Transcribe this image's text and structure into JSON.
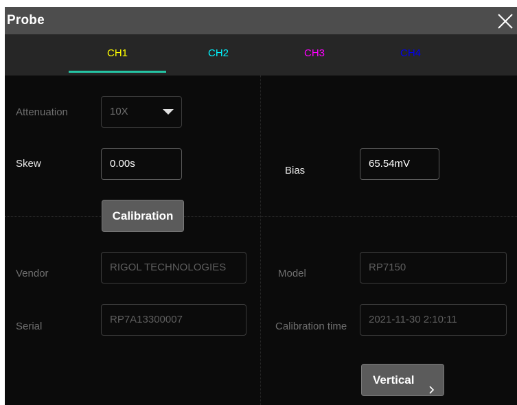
{
  "dialog": {
    "title": "Probe",
    "close_icon": "close-icon"
  },
  "tabs": [
    {
      "label": "CH1",
      "color": "#ffff00",
      "active": true
    },
    {
      "label": "CH2",
      "color": "#00f5ff",
      "active": false
    },
    {
      "label": "CH3",
      "color": "#ff00ff",
      "active": false
    },
    {
      "label": "CH4",
      "color": "#0000ee",
      "active": false
    }
  ],
  "accent_color": "#25c4a4",
  "form": {
    "attenuation": {
      "label": "Attenuation",
      "value": "10X"
    },
    "skew": {
      "label": "Skew",
      "value": "0.00s"
    },
    "bias": {
      "label": "Bias",
      "value": "65.54mV"
    },
    "calibration_button": "Calibration",
    "vendor": {
      "label": "Vendor",
      "value": "RIGOL TECHNOLOGIES"
    },
    "model": {
      "label": "Model",
      "value": "RP7150"
    },
    "serial": {
      "label": "Serial",
      "value": "RP7A13300007"
    },
    "calibration_time": {
      "label": "Calibration time",
      "value": "2021-11-30 2:10:11"
    },
    "vertical_button": {
      "label": "Vertical",
      "icon": "chevron-right-icon"
    }
  }
}
